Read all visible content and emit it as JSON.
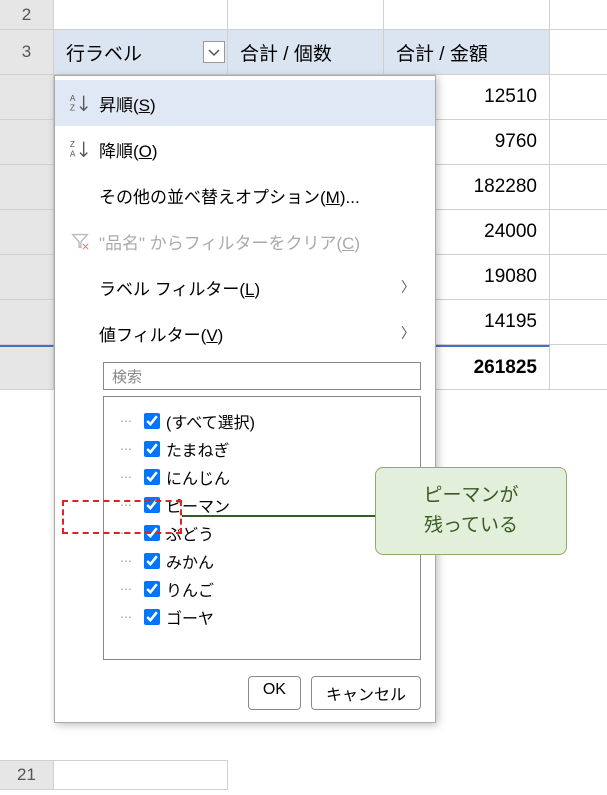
{
  "rows": {
    "r2": "2",
    "r3": "3",
    "r21": "21"
  },
  "headers": {
    "rowlabel": "行ラベル",
    "sum_count": "合計 / 個数",
    "sum_amount": "合計 / 金額"
  },
  "amounts": [
    "12510",
    "9760",
    "182280",
    "24000",
    "19080",
    "14195"
  ],
  "total_amount": "261825",
  "menu": {
    "sort_asc": "昇順(",
    "sort_asc_key": "S",
    "sort_asc_end": ")",
    "sort_desc": "降順(",
    "sort_desc_key": "O",
    "sort_desc_end": ")",
    "more_sort": "その他の並べ替えオプション(",
    "more_sort_key": "M",
    "more_sort_end": ")...",
    "clear_filter_pre": "\"品名\" からフィルターをクリア(",
    "clear_filter_key": "C",
    "clear_filter_end": ")",
    "label_filter": "ラベル フィルター(",
    "label_filter_key": "L",
    "label_filter_end": ")",
    "value_filter": "値フィルター(",
    "value_filter_key": "V",
    "value_filter_end": ")"
  },
  "search_placeholder": "検索",
  "checklist": [
    "(すべて選択)",
    "たまねぎ",
    "にんじん",
    "ピーマン",
    "ぶどう",
    "みかん",
    "りんご",
    "ゴーヤ"
  ],
  "buttons": {
    "ok": "OK",
    "cancel": "キャンセル"
  },
  "callout": {
    "l1": "ピーマンが",
    "l2": "残っている"
  }
}
